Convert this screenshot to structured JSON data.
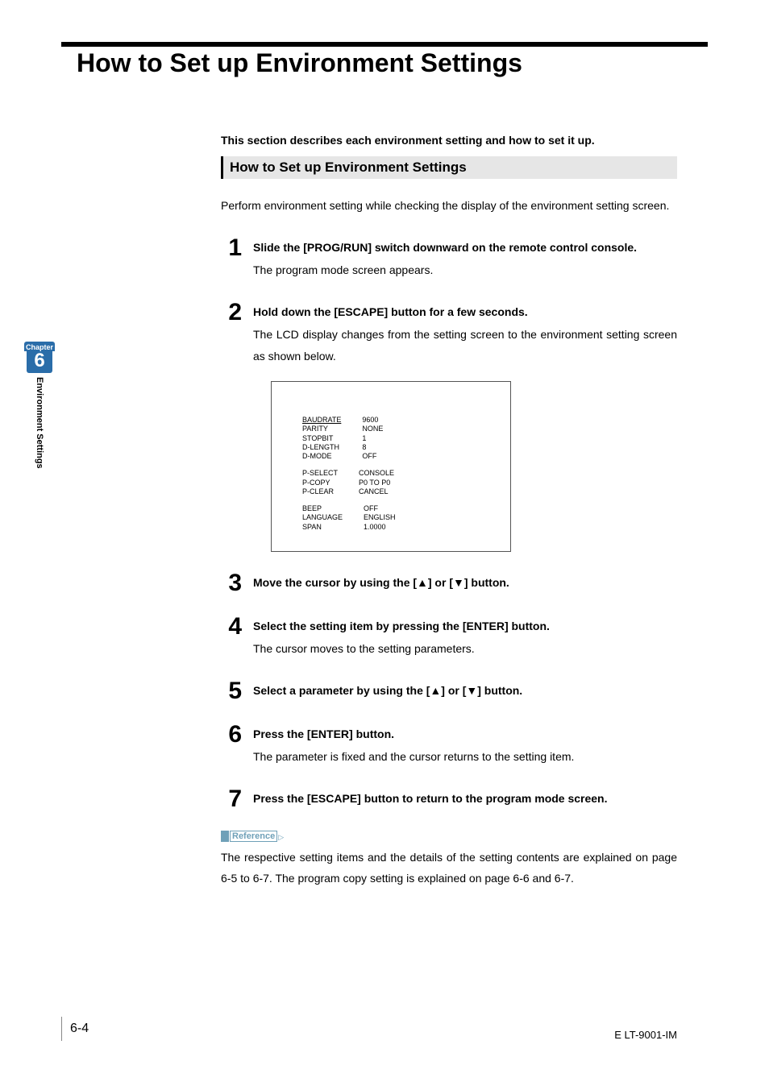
{
  "title": "How to Set up Environment Settings",
  "intro": "This section describes each environment setting and how to set it up.",
  "subhead": "How to Set up Environment Settings",
  "body": "Perform environment setting while checking the display of the environment setting screen.",
  "steps": [
    {
      "n": "1",
      "label": "Slide the [PROG/RUN] switch downward on the remote control console.",
      "desc": "The program mode screen appears."
    },
    {
      "n": "2",
      "label": "Hold down the [ESCAPE] button for a few seconds.",
      "desc": "The LCD display changes from the setting screen to the environment setting screen as shown below."
    },
    {
      "n": "3",
      "label": "Move the cursor by using the [▲] or [▼] button.",
      "desc": ""
    },
    {
      "n": "4",
      "label": "Select the setting item by pressing the [ENTER] button.",
      "desc": "The cursor moves to the setting parameters."
    },
    {
      "n": "5",
      "label": "Select a parameter by using the [▲] or [▼] button.",
      "desc": ""
    },
    {
      "n": "6",
      "label": "Press the [ENTER] button.",
      "desc": "The parameter is fixed and the cursor returns to the setting item."
    },
    {
      "n": "7",
      "label": "Press the [ESCAPE] button to return to the program mode screen.",
      "desc": ""
    }
  ],
  "lcd": {
    "g1": {
      "k": [
        "BAUDRATE",
        "PARITY",
        "STOPBIT",
        "D-LENGTH",
        "D-MODE"
      ],
      "v": [
        "9600",
        "NONE",
        "1",
        "8",
        "OFF"
      ]
    },
    "g2": {
      "k": [
        "P-SELECT",
        "P-COPY",
        "P-CLEAR"
      ],
      "v": [
        "CONSOLE",
        "P0 TO P0",
        "CANCEL"
      ]
    },
    "g3": {
      "k": [
        "BEEP",
        "LANGUAGE",
        "SPAN"
      ],
      "v": [
        "OFF",
        "ENGLISH",
        "1.0000"
      ]
    }
  },
  "reference": {
    "label": "Reference",
    "text": "The respective setting items and the details of the setting contents are explained on page 6-5 to 6-7. The program copy setting is explained on page 6-6 and 6-7."
  },
  "side": {
    "chapter_word": "Chapter",
    "chapter_num": "6",
    "label": "Environment Settings"
  },
  "footer": {
    "left": "6-4",
    "right": "E LT-9001-IM"
  }
}
